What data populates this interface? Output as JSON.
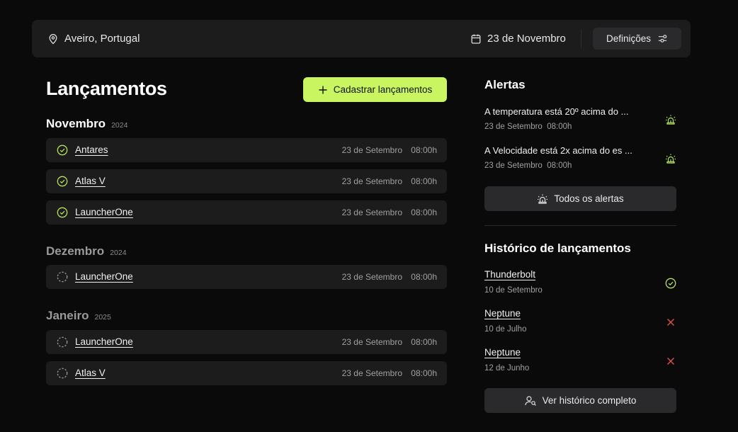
{
  "topbar": {
    "location": "Aveiro, Portugal",
    "date": "23 de Novembro",
    "settings_label": "Definições"
  },
  "launches": {
    "title": "Lançamentos",
    "add_label": "Cadastrar lançamentos",
    "groups": [
      {
        "month": "Novembro",
        "year": "2024",
        "items": [
          {
            "name": "Antares",
            "date": "23 de Setembro",
            "time": "08:00h",
            "status": "done"
          },
          {
            "name": "Atlas V",
            "date": "23 de Setembro",
            "time": "08:00h",
            "status": "done"
          },
          {
            "name": "LauncherOne",
            "date": "23 de Setembro",
            "time": "08:00h",
            "status": "done"
          }
        ]
      },
      {
        "month": "Dezembro",
        "year": "2024",
        "items": [
          {
            "name": "LauncherOne",
            "date": "23 de Setembro",
            "time": "08:00h",
            "status": "pending"
          }
        ]
      },
      {
        "month": "Janeiro",
        "year": "2025",
        "items": [
          {
            "name": "LauncherOne",
            "date": "23 de Setembro",
            "time": "08:00h",
            "status": "pending"
          },
          {
            "name": "Atlas V",
            "date": "23 de Setembro",
            "time": "08:00h",
            "status": "pending"
          }
        ]
      }
    ]
  },
  "alerts": {
    "title": "Alertas",
    "items": [
      {
        "text": "A temperatura está 20º acima do  ...",
        "date": "23 de Setembro",
        "time": "08:00h",
        "icon": "siren-icon"
      },
      {
        "text": "A Velocidade está 2x acima do es  ...",
        "date": "23 de Setembro",
        "time": "08:00h",
        "icon": "siren-icon"
      }
    ],
    "all_label": "Todos os alertas"
  },
  "history": {
    "title": "Histórico de lançamentos",
    "items": [
      {
        "name": "Thunderbolt",
        "date": "10 de Setembro",
        "status": "success"
      },
      {
        "name": "Neptune",
        "date": "10 de Julho",
        "status": "failed"
      },
      {
        "name": "Neptune",
        "date": "12 de Junho",
        "status": "failed"
      }
    ],
    "full_label": "Ver histórico completo"
  },
  "colors": {
    "accent": "#c8f560",
    "success": "#b4e05a",
    "failed": "#e0524a",
    "card": "#1c1c1d",
    "background": "#0a0a0a"
  }
}
